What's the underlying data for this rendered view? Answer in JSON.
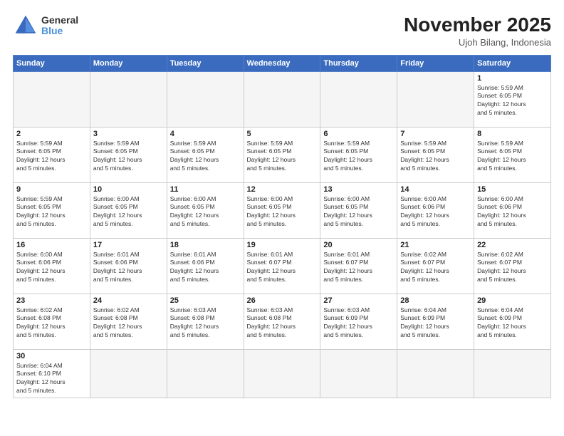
{
  "header": {
    "logo_general": "General",
    "logo_blue": "Blue",
    "month_title": "November 2025",
    "location": "Ujoh Bilang, Indonesia"
  },
  "weekdays": [
    "Sunday",
    "Monday",
    "Tuesday",
    "Wednesday",
    "Thursday",
    "Friday",
    "Saturday"
  ],
  "weeks": [
    [
      {
        "day": "",
        "info": ""
      },
      {
        "day": "",
        "info": ""
      },
      {
        "day": "",
        "info": ""
      },
      {
        "day": "",
        "info": ""
      },
      {
        "day": "",
        "info": ""
      },
      {
        "day": "",
        "info": ""
      },
      {
        "day": "1",
        "info": "Sunrise: 5:59 AM\nSunset: 6:05 PM\nDaylight: 12 hours\nand 5 minutes."
      }
    ],
    [
      {
        "day": "2",
        "info": "Sunrise: 5:59 AM\nSunset: 6:05 PM\nDaylight: 12 hours\nand 5 minutes."
      },
      {
        "day": "3",
        "info": "Sunrise: 5:59 AM\nSunset: 6:05 PM\nDaylight: 12 hours\nand 5 minutes."
      },
      {
        "day": "4",
        "info": "Sunrise: 5:59 AM\nSunset: 6:05 PM\nDaylight: 12 hours\nand 5 minutes."
      },
      {
        "day": "5",
        "info": "Sunrise: 5:59 AM\nSunset: 6:05 PM\nDaylight: 12 hours\nand 5 minutes."
      },
      {
        "day": "6",
        "info": "Sunrise: 5:59 AM\nSunset: 6:05 PM\nDaylight: 12 hours\nand 5 minutes."
      },
      {
        "day": "7",
        "info": "Sunrise: 5:59 AM\nSunset: 6:05 PM\nDaylight: 12 hours\nand 5 minutes."
      },
      {
        "day": "8",
        "info": "Sunrise: 5:59 AM\nSunset: 6:05 PM\nDaylight: 12 hours\nand 5 minutes."
      }
    ],
    [
      {
        "day": "9",
        "info": "Sunrise: 5:59 AM\nSunset: 6:05 PM\nDaylight: 12 hours\nand 5 minutes."
      },
      {
        "day": "10",
        "info": "Sunrise: 6:00 AM\nSunset: 6:05 PM\nDaylight: 12 hours\nand 5 minutes."
      },
      {
        "day": "11",
        "info": "Sunrise: 6:00 AM\nSunset: 6:05 PM\nDaylight: 12 hours\nand 5 minutes."
      },
      {
        "day": "12",
        "info": "Sunrise: 6:00 AM\nSunset: 6:05 PM\nDaylight: 12 hours\nand 5 minutes."
      },
      {
        "day": "13",
        "info": "Sunrise: 6:00 AM\nSunset: 6:05 PM\nDaylight: 12 hours\nand 5 minutes."
      },
      {
        "day": "14",
        "info": "Sunrise: 6:00 AM\nSunset: 6:06 PM\nDaylight: 12 hours\nand 5 minutes."
      },
      {
        "day": "15",
        "info": "Sunrise: 6:00 AM\nSunset: 6:06 PM\nDaylight: 12 hours\nand 5 minutes."
      }
    ],
    [
      {
        "day": "16",
        "info": "Sunrise: 6:00 AM\nSunset: 6:06 PM\nDaylight: 12 hours\nand 5 minutes."
      },
      {
        "day": "17",
        "info": "Sunrise: 6:01 AM\nSunset: 6:06 PM\nDaylight: 12 hours\nand 5 minutes."
      },
      {
        "day": "18",
        "info": "Sunrise: 6:01 AM\nSunset: 6:06 PM\nDaylight: 12 hours\nand 5 minutes."
      },
      {
        "day": "19",
        "info": "Sunrise: 6:01 AM\nSunset: 6:07 PM\nDaylight: 12 hours\nand 5 minutes."
      },
      {
        "day": "20",
        "info": "Sunrise: 6:01 AM\nSunset: 6:07 PM\nDaylight: 12 hours\nand 5 minutes."
      },
      {
        "day": "21",
        "info": "Sunrise: 6:02 AM\nSunset: 6:07 PM\nDaylight: 12 hours\nand 5 minutes."
      },
      {
        "day": "22",
        "info": "Sunrise: 6:02 AM\nSunset: 6:07 PM\nDaylight: 12 hours\nand 5 minutes."
      }
    ],
    [
      {
        "day": "23",
        "info": "Sunrise: 6:02 AM\nSunset: 6:08 PM\nDaylight: 12 hours\nand 5 minutes."
      },
      {
        "day": "24",
        "info": "Sunrise: 6:02 AM\nSunset: 6:08 PM\nDaylight: 12 hours\nand 5 minutes."
      },
      {
        "day": "25",
        "info": "Sunrise: 6:03 AM\nSunset: 6:08 PM\nDaylight: 12 hours\nand 5 minutes."
      },
      {
        "day": "26",
        "info": "Sunrise: 6:03 AM\nSunset: 6:08 PM\nDaylight: 12 hours\nand 5 minutes."
      },
      {
        "day": "27",
        "info": "Sunrise: 6:03 AM\nSunset: 6:09 PM\nDaylight: 12 hours\nand 5 minutes."
      },
      {
        "day": "28",
        "info": "Sunrise: 6:04 AM\nSunset: 6:09 PM\nDaylight: 12 hours\nand 5 minutes."
      },
      {
        "day": "29",
        "info": "Sunrise: 6:04 AM\nSunset: 6:09 PM\nDaylight: 12 hours\nand 5 minutes."
      }
    ],
    [
      {
        "day": "30",
        "info": "Sunrise: 6:04 AM\nSunset: 6:10 PM\nDaylight: 12 hours\nand 5 minutes."
      },
      {
        "day": "",
        "info": ""
      },
      {
        "day": "",
        "info": ""
      },
      {
        "day": "",
        "info": ""
      },
      {
        "day": "",
        "info": ""
      },
      {
        "day": "",
        "info": ""
      },
      {
        "day": "",
        "info": ""
      }
    ]
  ]
}
